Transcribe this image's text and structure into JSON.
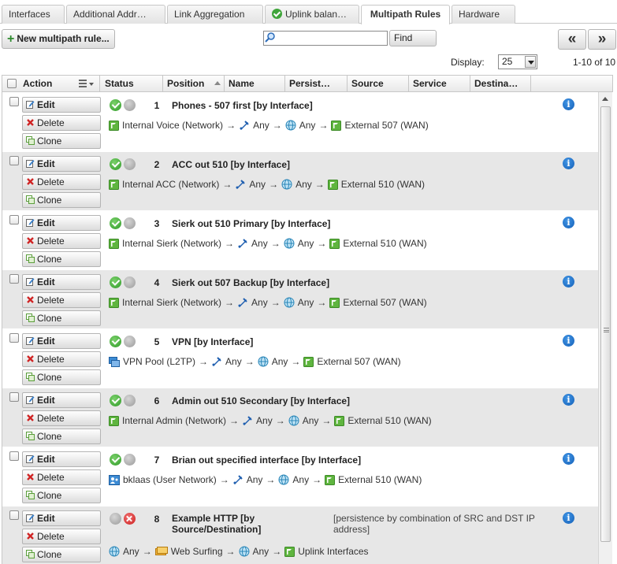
{
  "tabs": [
    {
      "label": "Interfaces",
      "active": false
    },
    {
      "label": "Additional Addr…",
      "active": false
    },
    {
      "label": "Link Aggregation",
      "active": false
    },
    {
      "label": "Uplink balan…",
      "active": false,
      "icon": "check-circle-icon"
    },
    {
      "label": "Multipath Rules",
      "active": true
    },
    {
      "label": "Hardware",
      "active": false
    }
  ],
  "toolbar": {
    "new_label": "New multipath rule...",
    "search_value": "",
    "find_label": "Find",
    "prev_label": "«",
    "next_label": "»"
  },
  "display": {
    "label": "Display:",
    "value": "25",
    "page_info": "1-10 of 10"
  },
  "columns": [
    "Action",
    "Status",
    "Position",
    "Name",
    "Persist…",
    "Source",
    "Service",
    "Destina…"
  ],
  "actions": {
    "edit": "Edit",
    "delete": "Delete",
    "clone": "Clone"
  },
  "arrow": "→",
  "rules": [
    {
      "enabled": true,
      "error": false,
      "position": "1",
      "name": "Phones - 507 first [by Interface]",
      "persistence": "",
      "source_icon": "network-icon",
      "source": "Internal Voice (Network)",
      "service_icon": "any-service-icon",
      "service": "Any",
      "dest_icon": "globe-icon",
      "destination": "Any",
      "iface_icon": "interface-icon",
      "interface": "External 507 (WAN)"
    },
    {
      "enabled": true,
      "error": false,
      "position": "2",
      "name": "ACC out 510 [by Interface]",
      "persistence": "",
      "source_icon": "network-icon",
      "source": "Internal ACC (Network)",
      "service_icon": "any-service-icon",
      "service": "Any",
      "dest_icon": "globe-icon",
      "destination": "Any",
      "iface_icon": "interface-icon",
      "interface": "External 510 (WAN)"
    },
    {
      "enabled": true,
      "error": false,
      "position": "3",
      "name": "Sierk out 510 Primary [by Interface]",
      "persistence": "",
      "source_icon": "network-icon",
      "source": "Internal Sierk (Network)",
      "service_icon": "any-service-icon",
      "service": "Any",
      "dest_icon": "globe-icon",
      "destination": "Any",
      "iface_icon": "interface-icon",
      "interface": "External 510 (WAN)"
    },
    {
      "enabled": true,
      "error": false,
      "position": "4",
      "name": "Sierk out 507 Backup [by Interface]",
      "persistence": "",
      "source_icon": "network-icon",
      "source": "Internal Sierk (Network)",
      "service_icon": "any-service-icon",
      "service": "Any",
      "dest_icon": "globe-icon",
      "destination": "Any",
      "iface_icon": "interface-icon",
      "interface": "External 507 (WAN)"
    },
    {
      "enabled": true,
      "error": false,
      "position": "5",
      "name": "VPN [by Interface]",
      "persistence": "",
      "source_icon": "vpn-pool-icon",
      "source": "VPN Pool (L2TP)",
      "service_icon": "any-service-icon",
      "service": "Any",
      "dest_icon": "globe-icon",
      "destination": "Any",
      "iface_icon": "interface-icon",
      "interface": "External 507 (WAN)"
    },
    {
      "enabled": true,
      "error": false,
      "position": "6",
      "name": "Admin out 510 Secondary [by Interface]",
      "persistence": "",
      "source_icon": "network-icon",
      "source": "Internal Admin (Network)",
      "service_icon": "any-service-icon",
      "service": "Any",
      "dest_icon": "globe-icon",
      "destination": "Any",
      "iface_icon": "interface-icon",
      "interface": "External 510 (WAN)"
    },
    {
      "enabled": true,
      "error": false,
      "position": "7",
      "name": "Brian out specified interface [by Interface]",
      "persistence": "",
      "source_icon": "user-network-icon",
      "source": "bklaas (User Network)",
      "service_icon": "any-service-icon",
      "service": "Any",
      "dest_icon": "globe-icon",
      "destination": "Any",
      "iface_icon": "interface-icon",
      "interface": "External 510 (WAN)"
    },
    {
      "enabled": false,
      "error": true,
      "position": "8",
      "name": "Example HTTP [by Source/Destination]",
      "persistence": "[persistence by combination of SRC and DST IP address]",
      "source_icon": "globe-icon",
      "source": "Any",
      "service_icon": "service-group-icon",
      "service": "Web Surfing",
      "dest_icon": "globe-icon",
      "destination": "Any",
      "iface_icon": "interface-icon",
      "interface": "Uplink Interfaces"
    }
  ]
}
